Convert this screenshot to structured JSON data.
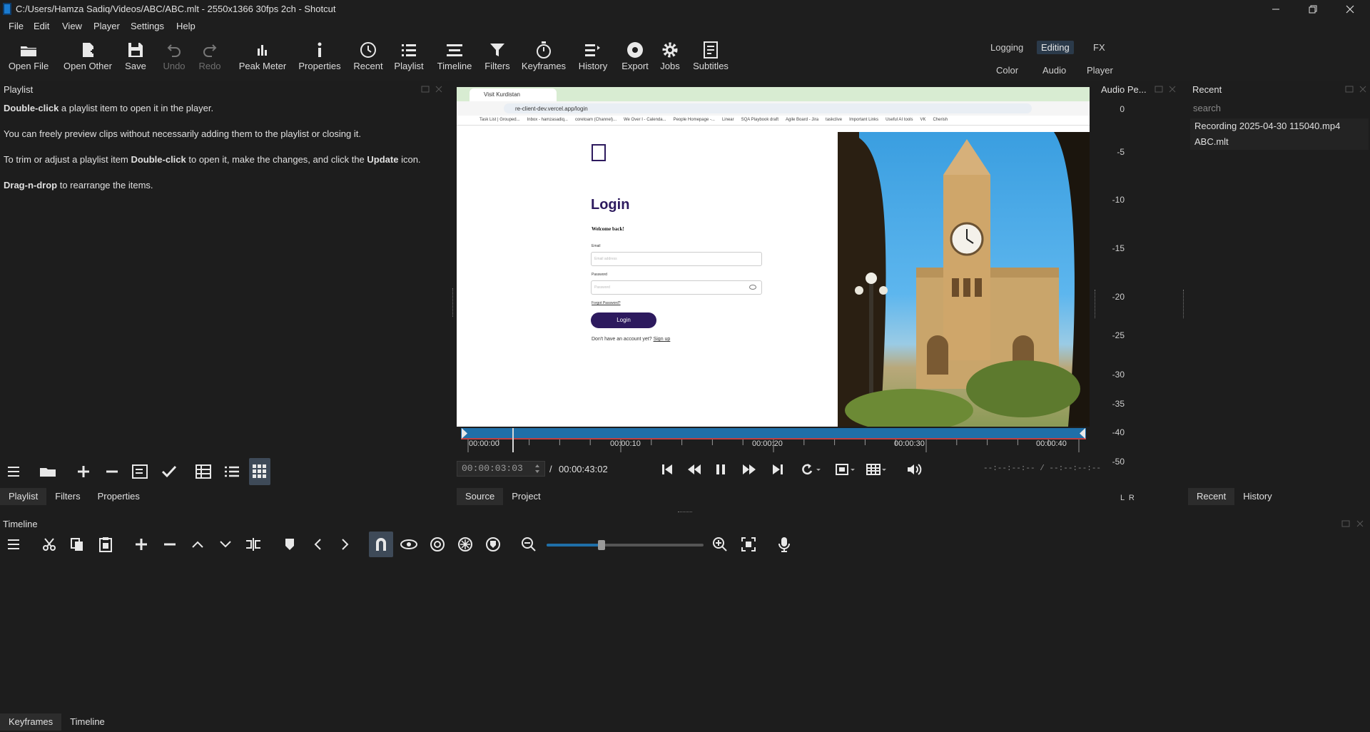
{
  "window": {
    "title": "C:/Users/Hamza Sadiq/Videos/ABC/ABC.mlt - 2550x1366 30fps 2ch - Shotcut",
    "controls": [
      "minimize-icon",
      "restore-icon",
      "close-icon"
    ]
  },
  "menu": [
    "File",
    "Edit",
    "View",
    "Player",
    "Settings",
    "Help"
  ],
  "toolbar": [
    {
      "label": "Open File",
      "icon": "folder-open-icon",
      "enabled": true
    },
    {
      "label": "Open Other",
      "icon": "open-other-icon",
      "enabled": true
    },
    {
      "label": "Save",
      "icon": "save-icon",
      "enabled": true
    },
    {
      "label": "Undo",
      "icon": "undo-icon",
      "enabled": false
    },
    {
      "label": "Redo",
      "icon": "redo-icon",
      "enabled": false
    },
    {
      "label": "Peak Meter",
      "icon": "peak-meter-icon",
      "enabled": true
    },
    {
      "label": "Properties",
      "icon": "info-icon",
      "enabled": true
    },
    {
      "label": "Recent",
      "icon": "clock-icon",
      "enabled": true
    },
    {
      "label": "Playlist",
      "icon": "list-icon",
      "enabled": true
    },
    {
      "label": "Timeline",
      "icon": "timeline-icon",
      "enabled": true
    },
    {
      "label": "Filters",
      "icon": "filter-icon",
      "enabled": true
    },
    {
      "label": "Keyframes",
      "icon": "stopwatch-icon",
      "enabled": true
    },
    {
      "label": "History",
      "icon": "history-icon",
      "enabled": true
    },
    {
      "label": "Export",
      "icon": "export-icon",
      "enabled": true
    },
    {
      "label": "Jobs",
      "icon": "gear-icon",
      "enabled": true
    },
    {
      "label": "Subtitles",
      "icon": "subtitles-icon",
      "enabled": true
    }
  ],
  "layouts": {
    "top": [
      "Logging",
      "Editing",
      "FX"
    ],
    "bottom": [
      "Color",
      "Audio",
      "Player"
    ],
    "selected": "Editing"
  },
  "playlist": {
    "title": "Playlist",
    "help": [
      {
        "bold": "Double-click",
        "rest": " a playlist item to open it in the player."
      },
      {
        "bold": "",
        "rest": "You can freely preview clips without necessarily adding them to the playlist or closing it."
      },
      {
        "pre": "To trim or adjust a playlist item ",
        "bold": "Double-click",
        "mid": " to open it, make the changes, and click the ",
        "bold2": "Update",
        "rest": " icon."
      },
      {
        "bold": "Drag-n-drop",
        "rest": " to rearrange the items."
      }
    ],
    "tabs": [
      "Playlist",
      "Filters",
      "Properties"
    ]
  },
  "player": {
    "browser": {
      "tab_title": "Visit Kurdistan",
      "url": "re-client-dev.vercel.app/login",
      "bookmarks": [
        "Task List | Grouped...",
        "Inbox - hamzasadiq...",
        "coretoam (Channel)...",
        "We Over I - Calenda...",
        "People Homepage -...",
        "Linear",
        "SQA Playbook draft",
        "Agile Board - Jira",
        "taskclive",
        "Important Links",
        "Useful AI tools",
        "VK",
        "Cherish"
      ]
    },
    "login": {
      "heading": "Login",
      "welcome": "Welcome back!",
      "email_label": "Email",
      "email_placeholder": "Email address",
      "password_label": "Password",
      "password_placeholder": "Password",
      "forgot": "Forgot Password?",
      "button": "Login",
      "signup_prompt": "Don't have an account yet?",
      "signup_link": "Sign up"
    },
    "ruler_labels": [
      "00:00:00",
      "00:00:10",
      "00:00:20",
      "00:00:30",
      "00:00:40"
    ],
    "playhead_fraction": 0.072,
    "timecode": "00:00:03:03",
    "duration": "00:00:43:02",
    "in_out": "--:--:--:-- / --:--:--:--",
    "tabs": [
      "Source",
      "Project"
    ],
    "selected_tab": "Source"
  },
  "audio_meter": {
    "title": "Audio Pe...",
    "scale": [
      "0",
      "-5",
      "-10",
      "-15",
      "-20",
      "-25",
      "-30",
      "-35",
      "-40",
      "-50"
    ],
    "channels": "L  R"
  },
  "recent": {
    "title": "Recent",
    "search_placeholder": "search",
    "items": [
      "Recording 2025-04-30 115040.mp4",
      "ABC.mlt"
    ],
    "tabs": [
      "Recent",
      "History"
    ]
  },
  "timeline": {
    "title": "Timeline",
    "tools": [
      "menu-icon",
      "cut-icon",
      "copy-icon",
      "paste-icon",
      "append-icon",
      "ripple-delete-icon",
      "lift-icon",
      "overwrite-icon",
      "split-icon",
      "marker-icon",
      "prev-marker-icon",
      "next-marker-icon",
      "snap-icon",
      "scrub-icon",
      "ripple-icon",
      "ripple-all-icon",
      "ripple-markers-icon",
      "zoom-out-icon",
      "zoom-slider",
      "zoom-in-icon",
      "zoom-fit-icon",
      "record-audio-icon"
    ],
    "zoom_fraction": 0.35
  },
  "bottom_tabs": [
    "Keyframes",
    "Timeline"
  ],
  "colors": {
    "accent": "#1f6fa8",
    "background": "#1d1d1d",
    "login_purple": "#2d1a5e"
  }
}
